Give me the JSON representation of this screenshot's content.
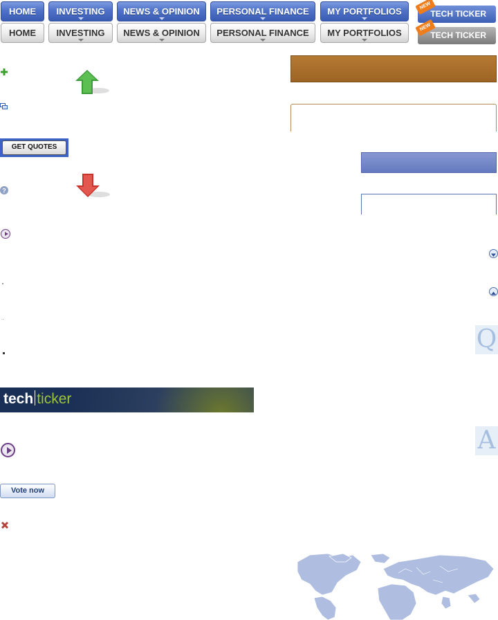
{
  "nav_primary": {
    "home": "HOME",
    "investing": "INVESTING",
    "news": "NEWS & OPINION",
    "personal_finance": "PERSONAL FINANCE",
    "portfolios": "MY PORTFOLIOS",
    "tech_ticker": "TECH TICKER",
    "new_badge": "NEW"
  },
  "nav_secondary": {
    "home": "HOME",
    "investing": "INVESTING",
    "news": "NEWS & OPINION",
    "personal_finance": "PERSONAL FINANCE",
    "portfolios": "MY PORTFOLIOS",
    "tech_ticker": "TECH TICKER",
    "new_badge": "NEW"
  },
  "quotes": {
    "get_quotes_label": "GET QUOTES"
  },
  "banner": {
    "word1": "tech",
    "word2": "ticker"
  },
  "poll": {
    "vote_label": "Vote now"
  },
  "qa": {
    "q": "Q",
    "a": "A"
  },
  "colors": {
    "nav_blue": "#4f72c8",
    "accent_brown": "#a0662a",
    "panel_blue": "#7389c8"
  }
}
